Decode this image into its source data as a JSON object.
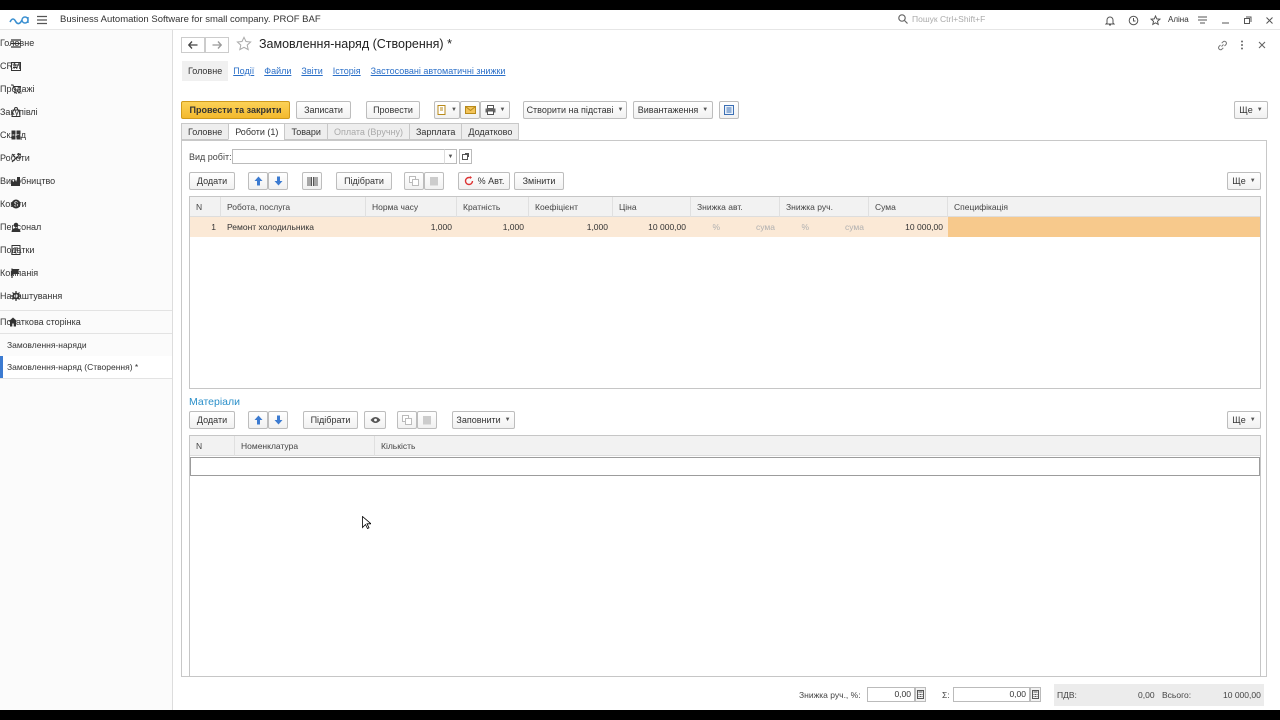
{
  "app": {
    "title": "Business Automation Software for small company. PROF BAF",
    "search_placeholder": "Пошук Ctrl+Shift+F",
    "user": "Аліна"
  },
  "sidebar": {
    "items": [
      {
        "label": "Головне",
        "icon": "menu-icon"
      },
      {
        "label": "CRM",
        "icon": "crm-icon"
      },
      {
        "label": "Продажі",
        "icon": "sales-icon"
      },
      {
        "label": "Закупівлі",
        "icon": "purchases-icon"
      },
      {
        "label": "Склад",
        "icon": "warehouse-icon"
      },
      {
        "label": "Роботи",
        "icon": "tools-icon"
      },
      {
        "label": "Виробництво",
        "icon": "production-icon"
      },
      {
        "label": "Кошти",
        "icon": "money-icon"
      },
      {
        "label": "Персонал",
        "icon": "staff-icon"
      },
      {
        "label": "Податки",
        "icon": "taxes-icon"
      },
      {
        "label": "Компанія",
        "icon": "flag-icon"
      },
      {
        "label": "Налаштування",
        "icon": "gear-icon"
      }
    ],
    "home": "Початкова сторінка",
    "open_windows": [
      "Замовлення-наряди",
      "Замовлення-наряд (Створення) *"
    ]
  },
  "document": {
    "title": "Замовлення-наряд (Створення) *",
    "subnav": [
      "Головне",
      "Події",
      "Файли",
      "Звіти",
      "Історія",
      "Застосовані автоматичні знижки"
    ]
  },
  "toolbar": {
    "post_close": "Провести та закрити",
    "save": "Записати",
    "post": "Провести",
    "create_based": "Створити на підставі",
    "export": "Вивантаження",
    "more": "Ще"
  },
  "tabs": [
    "Головне",
    "Роботи (1)",
    "Товари",
    "Оплата (Вручну)",
    "Зарплата",
    "Додатково"
  ],
  "works": {
    "type_label": "Вид робіт:",
    "type_value": "",
    "buttons": {
      "add": "Додати",
      "pick": "Підібрати",
      "auto_pct": "% Авт.",
      "change": "Змінити",
      "more": "Ще"
    },
    "columns": [
      "N",
      "Робота, послуга",
      "Норма часу",
      "Кратність",
      "Коефіцієнт",
      "Ціна",
      "Знижка авт.",
      "Знижка руч.",
      "Сума",
      "Специфікація"
    ],
    "rows": [
      {
        "n": "1",
        "work": "Ремонт холодильника",
        "norm": "1,000",
        "mult": "1,000",
        "coef": "1,000",
        "price": "10 000,00",
        "auto_pct": "%",
        "auto_sum": "сума",
        "man_pct": "%",
        "man_sum": "сума",
        "sum": "10 000,00",
        "spec": ""
      }
    ]
  },
  "materials": {
    "title": "Матеріали",
    "buttons": {
      "add": "Додати",
      "pick": "Підібрати",
      "fill": "Заповнити",
      "more": "Ще"
    },
    "columns": [
      "N",
      "Номенклатура",
      "Кількість"
    ]
  },
  "footer": {
    "discount_label": "Знижка руч., %:",
    "discount_value": "0,00",
    "sum_label": "Σ:",
    "sum_value": "0,00",
    "vat_label": "ПДВ:",
    "vat_value": "0,00",
    "total_label": "Всього:",
    "total_value": "10 000,00"
  },
  "colors": {
    "primary_button": "#f3b92d",
    "link": "#2a6fc8",
    "row_highlight": "#fbe9d6",
    "section_title": "#2a8fc9"
  }
}
